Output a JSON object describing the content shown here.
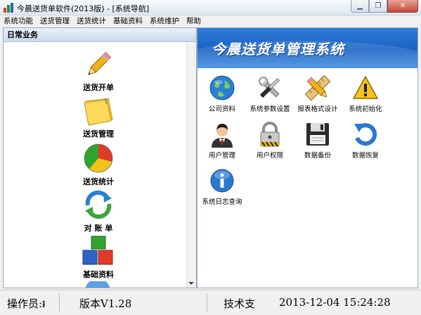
{
  "window": {
    "title": "今晨送货单软件(2013版) - [系统导航]",
    "buttons": {
      "minimize": "▁",
      "restore": "❐",
      "close": "✕"
    }
  },
  "menu": [
    "系统功能",
    "送货管理",
    "送货统计",
    "基础资料",
    "系统维护",
    "帮助"
  ],
  "left_panel": {
    "header": "日常业务",
    "items": [
      {
        "label": "送货开单",
        "icon": "pencil-icon"
      },
      {
        "label": "送货管理",
        "icon": "note-icon"
      },
      {
        "label": "送货统计",
        "icon": "pie-chart-icon"
      },
      {
        "label": "对 账 单",
        "icon": "refresh-arrows-icon"
      },
      {
        "label": "基础资料",
        "icon": "blocks-icon"
      }
    ]
  },
  "right_panel": {
    "banner": "今晨送货单管理系统",
    "tools": [
      {
        "label": "公司资料",
        "icon": "globe-icon"
      },
      {
        "label": "系统参数设置",
        "icon": "tools-icon"
      },
      {
        "label": "报表格式设计",
        "icon": "ruler-pencil-icon"
      },
      {
        "label": "系统初始化",
        "icon": "warning-icon"
      },
      {
        "label": "用户管理",
        "icon": "user-icon"
      },
      {
        "label": "用户权限",
        "icon": "lock-icon"
      },
      {
        "label": "数据备份",
        "icon": "floppy-icon"
      },
      {
        "label": "数据恢复",
        "icon": "restore-icon"
      },
      {
        "label": "系统日志查询",
        "icon": "info-icon"
      }
    ]
  },
  "status": {
    "operator": "操作员:៛",
    "version": "版本V1.28",
    "support": "技术支",
    "datetime": "2013-12-04  15:24:28"
  }
}
